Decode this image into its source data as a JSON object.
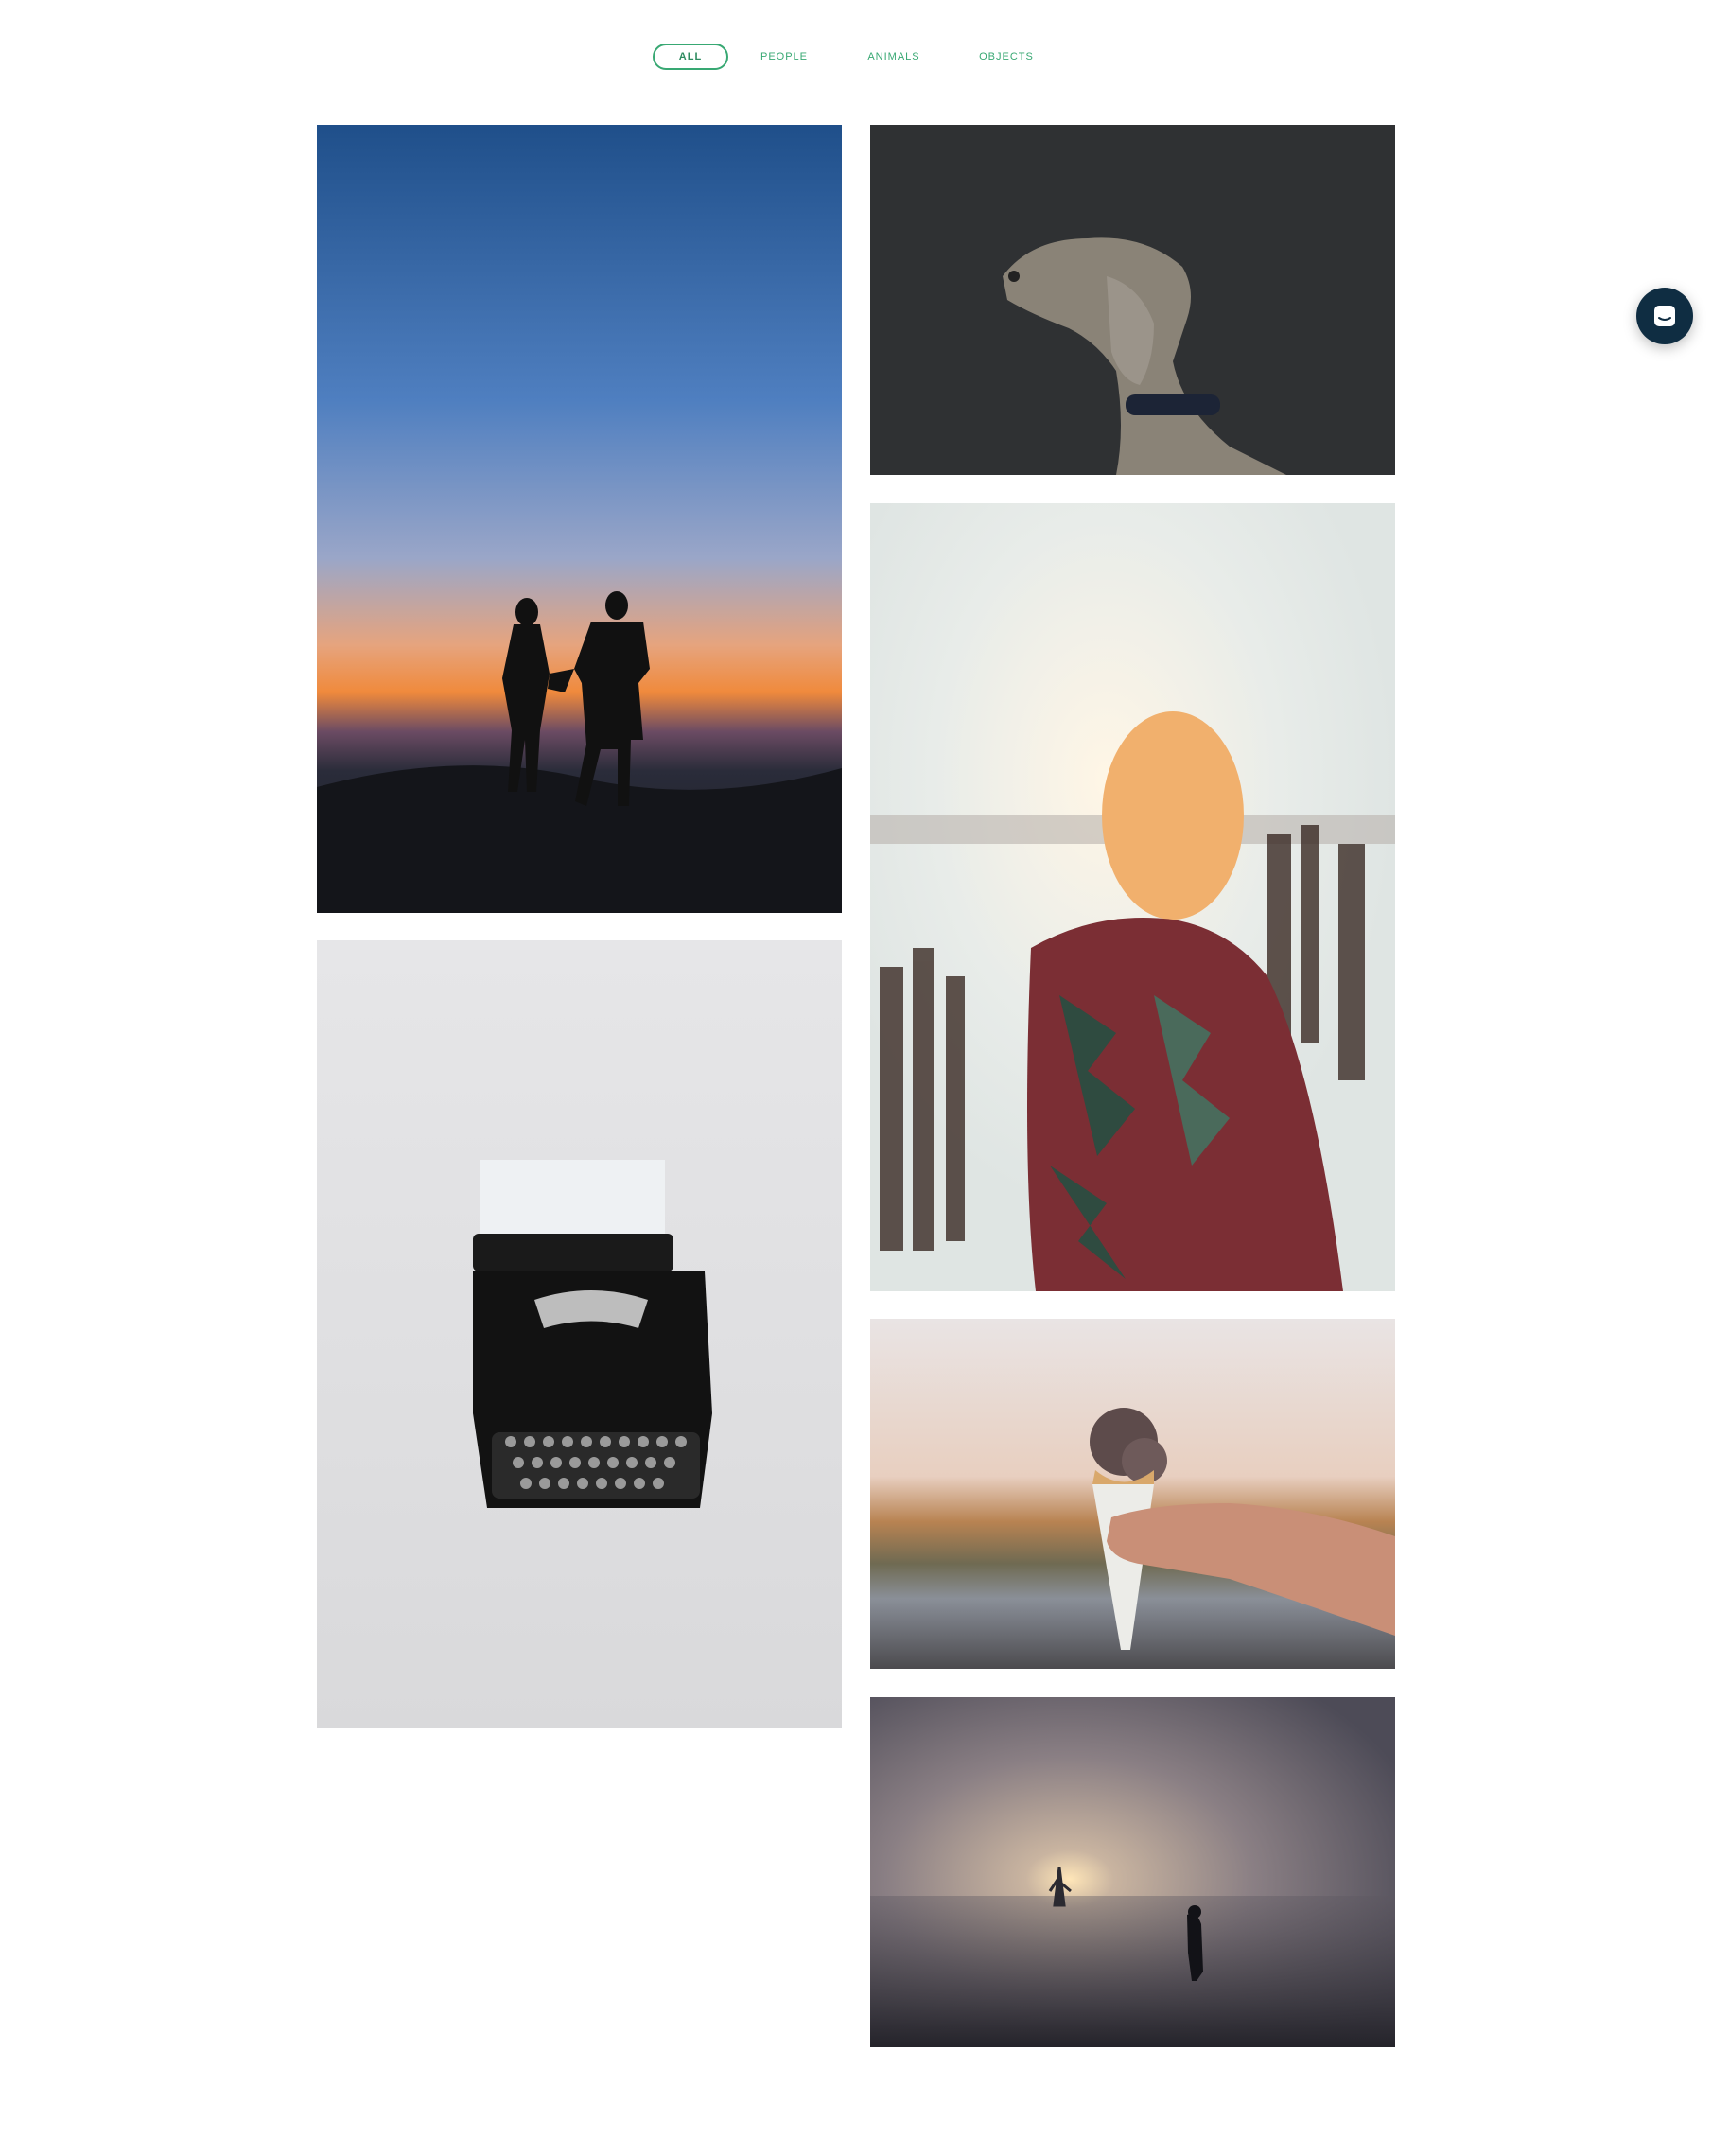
{
  "filters": [
    {
      "label": "ALL",
      "active": true
    },
    {
      "label": "PEOPLE",
      "active": false
    },
    {
      "label": "ANIMALS",
      "active": false
    },
    {
      "label": "OBJECTS",
      "active": false
    }
  ],
  "accent_color": "#38a873",
  "chat_launcher": {
    "icon": "chat-bubble-icon",
    "color": "#0f2d42"
  },
  "gallery": [
    {
      "subject": "couple-silhouette-sunset-photo",
      "category": "PEOPLE"
    },
    {
      "subject": "dog-portrait-photo",
      "category": "ANIMALS"
    },
    {
      "subject": "woman-blanket-sunlight-photo",
      "category": "PEOPLE"
    },
    {
      "subject": "typewriter-photo",
      "category": "OBJECTS"
    },
    {
      "subject": "ice-cream-cone-photo",
      "category": "OBJECTS"
    },
    {
      "subject": "foggy-field-sunrise-photo",
      "category": "PEOPLE"
    }
  ]
}
